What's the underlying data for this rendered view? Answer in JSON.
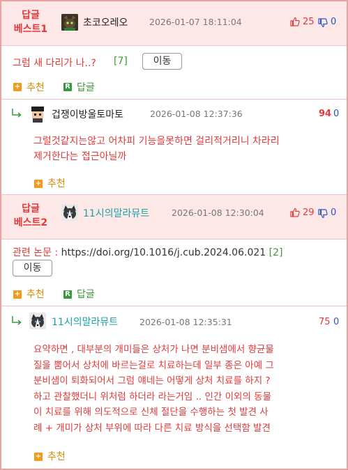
{
  "best1": {
    "badge_line1": "답글",
    "badge_line2": "베스트1",
    "nick": "초코오레오",
    "date": "2026-01-07 18:11:04",
    "up": "25",
    "down": "0",
    "text": "그럼 새 다리가 나..?",
    "count": "[7]",
    "move_btn": "이동",
    "recommend": "추천",
    "reply": "답글"
  },
  "reply1": {
    "nick": "겁쟁이방울토마토",
    "date": "2026-01-08 12:37:36",
    "up": "94",
    "down": "0",
    "line1": "그럴것같지는않고 어차피 기능을못하면 걸리적거리니 차라리",
    "line2": "제거한다는 접근아닐까",
    "recommend": "추천"
  },
  "best2": {
    "badge_line1": "답글",
    "badge_line2": "베스트2",
    "nick": "11시의말라뮤트",
    "date": "2026-01-08 12:30:04",
    "up": "29",
    "down": "0",
    "label": "관련 논문 :",
    "link": "https://doi.org/10.1016/j.cub.2024.06.021",
    "count": "[2]",
    "move_btn": "이동",
    "recommend": "추천",
    "reply": "답글"
  },
  "reply2": {
    "nick": "11시의말라뮤트",
    "date": "2026-01-08 12:35:31",
    "up": "75",
    "down": "0",
    "line1": "요약하면 , 대부분의 개미들은 상처가 나면 분비샘에서 향균물",
    "line2": "질을 뿜어서 상처에 바르는걸로 치료하는데 일부 종은 아예 그",
    "line3": "분비샘이 퇴화되어서 그럼 얘네는 어떻게 상처 치료를 하지 ?",
    "line4": "하고 관찰했더니 위처럼 하더라 라는거임 .. 인간 이외의 동물",
    "line5": "이 치료를 위해 의도적으로 신체 절단을 수행하는 첫 발견 사",
    "line6": "례 + 개미가 상처 부위에 따라 다른 치료 방식을 선택함 발견",
    "recommend": "추천"
  },
  "icons": {
    "thumb_up": "thumb-up-icon",
    "thumb_down": "thumb-down-icon",
    "reply_arrow": "reply-arrow-icon",
    "plus": "plus-icon",
    "r_badge": "r-icon"
  },
  "colors": {
    "accent_red": "#e23a3a",
    "header_pink": "#fde8e8",
    "teal_nick": "#1aa3a3",
    "down_blue": "#2a55c8",
    "green": "#3a9a3a",
    "orange": "#f29a1a"
  }
}
